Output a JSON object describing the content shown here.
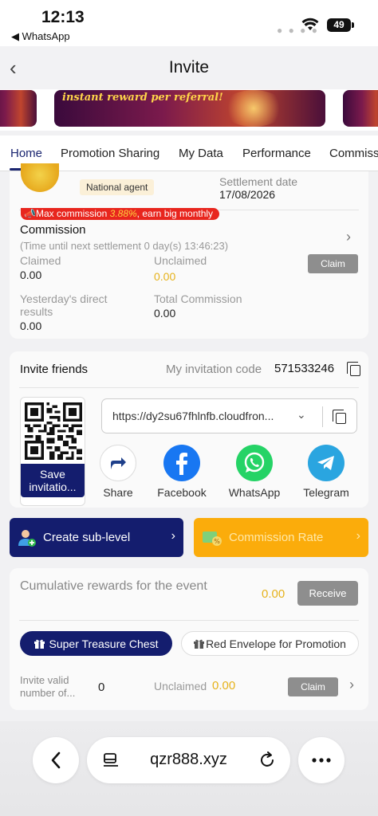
{
  "status": {
    "time": "12:13",
    "back_app": "◀ WhatsApp",
    "battery": "49"
  },
  "header": {
    "title": "Invite"
  },
  "banner": {
    "text": "instant reward per referral!"
  },
  "tabs": [
    "Home",
    "Promotion Sharing",
    "My Data",
    "Performance",
    "Commiss"
  ],
  "commission_card": {
    "agent_badge": "National agent",
    "settlement_label": "Settlement date",
    "settlement_date": "17/08/2026",
    "promo_prefix": "Max commission ",
    "promo_pct": "3.88%",
    "promo_suffix": ", earn big monthly",
    "title": "Commission",
    "next_settlement": "(Time until next settlement  0 day(s) 13:46:23)",
    "claimed_label": "Claimed",
    "claimed_value": "0.00",
    "unclaimed_label": "Unclaimed",
    "unclaimed_value": "0.00",
    "claim_button": "Claim",
    "yesterday_label": "Yesterday's direct results",
    "yesterday_value": "0.00",
    "total_label": "Total Commission",
    "total_value": "0.00"
  },
  "invite_card": {
    "title": "Invite friends",
    "code_label": "My invitation code",
    "code": "571533246",
    "save_button": "Save invitatio...",
    "link": "https://dy2su67fhlnfb.cloudfron...",
    "share": [
      {
        "label": "Share",
        "icon": "share-icon"
      },
      {
        "label": "Facebook",
        "icon": "facebook-icon",
        "color": "#1877f2"
      },
      {
        "label": "WhatsApp",
        "icon": "whatsapp-icon",
        "color": "#25d366"
      },
      {
        "label": "Telegram",
        "icon": "telegram-icon",
        "color": "#2aa5e0"
      }
    ]
  },
  "actions": {
    "create": "Create sub-level",
    "rate": "Commission Rate"
  },
  "rewards_card": {
    "cumulative_label": "Cumulative rewards for the event",
    "cumulative_value": "0.00",
    "receive_button": "Receive",
    "pill_active": "Super Treasure Chest",
    "pill_inactive": "Red Envelope for Promotion",
    "invite_valid_label": "Invite valid number of...",
    "invite_valid_value": "0",
    "unclaimed_label": "Unclaimed",
    "unclaimed_value": "0.00",
    "claim_button": "Claim"
  },
  "browser": {
    "url": "qzr888.xyz"
  },
  "colors": {
    "primary_navy": "#141d6e",
    "accent_orange": "#fbac0b",
    "gold_value": "#e6b21b",
    "promo_red": "#e8261e"
  }
}
